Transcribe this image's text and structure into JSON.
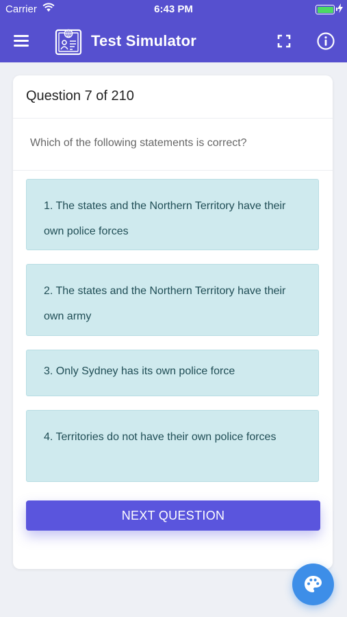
{
  "status_bar": {
    "carrier": "Carrier",
    "time": "6:43 PM"
  },
  "header": {
    "title": "Test Simulator",
    "icons": [
      "menu-icon",
      "app-logo-icon",
      "fullscreen-icon",
      "info-icon"
    ]
  },
  "question": {
    "counter": "Question 7 of 210",
    "text": "Which of the following statements is correct?",
    "answers": [
      {
        "label": "1. The states and the Northern Territory have their own police forces"
      },
      {
        "label": "2. The states and the Northern Territory have their own army"
      },
      {
        "label": "3. Only Sydney has its own police force"
      },
      {
        "label": "4. Territories do not have their own police forces"
      }
    ]
  },
  "actions": {
    "next_label": "NEXT QUESTION"
  },
  "fab": {
    "icon": "palette-icon"
  },
  "colors": {
    "header_bg": "#5650cf",
    "answer_bg": "#cfeaee",
    "next_button": "#5a55dd",
    "fab": "#3d8ee8",
    "battery": "#4cd964"
  }
}
